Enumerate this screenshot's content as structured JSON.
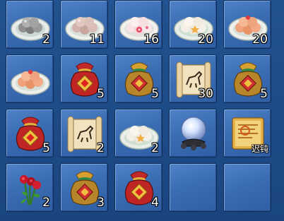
{
  "inventory": {
    "slots": [
      {
        "item": "plate-of-grey-dumplings-icon",
        "count": "2"
      },
      {
        "item": "plate-of-pink-dumplings-icon",
        "count": "11"
      },
      {
        "item": "plate-of-flower-dumplings-icon",
        "count": "16"
      },
      {
        "item": "plate-of-star-dumplings-icon",
        "count": "20"
      },
      {
        "item": "plate-of-orange-dumplings-icon",
        "count": "20"
      },
      {
        "item": "plate-of-orange-dumplings-icon",
        "count": ""
      },
      {
        "item": "red-lucky-bag-icon",
        "count": "5"
      },
      {
        "item": "gold-lucky-bag-icon",
        "count": "5"
      },
      {
        "item": "horse-scroll-icon",
        "count": "30"
      },
      {
        "item": "gold-lucky-bag-icon",
        "count": "5"
      },
      {
        "item": "red-lucky-bag-icon",
        "count": "5"
      },
      {
        "item": "horse-scroll-icon",
        "count": "2"
      },
      {
        "item": "plate-of-star-dumplings-icon",
        "count": "2"
      },
      {
        "item": "crystal-ball-icon",
        "count": ""
      },
      {
        "item": "skill-scroll-icon",
        "count": "",
        "tag": "迟钝"
      },
      {
        "item": "red-roses-icon",
        "count": "2"
      },
      {
        "item": "gold-lucky-bag-icon",
        "count": "3"
      },
      {
        "item": "red-lucky-bag-icon",
        "count": "4"
      },
      {
        "item": "empty-slot",
        "count": ""
      },
      {
        "item": "empty-slot",
        "count": ""
      }
    ]
  }
}
